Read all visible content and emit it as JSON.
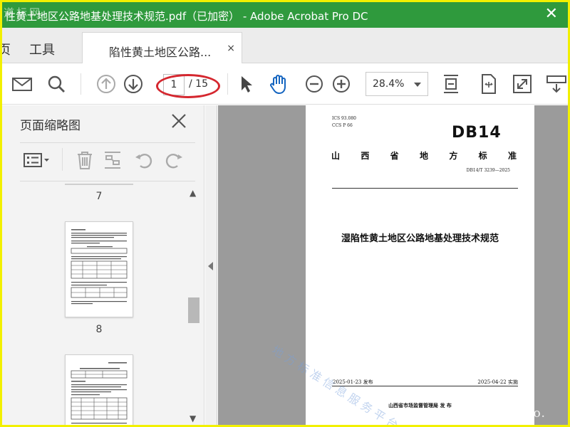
{
  "window": {
    "title": "性黄土地区公路地基处理技术规范.pdf（已加密） - Adobe Acrobat Pro DC",
    "close_glyph": "✕",
    "watermark_top_left": "道标网"
  },
  "nav": {
    "home_label": "页",
    "tools_label": "工具",
    "doc_tab_label": "陷性黄土地区公路...",
    "doc_tab_close": "×"
  },
  "toolbar": {
    "icons": [
      "mail-icon",
      "search-icon",
      "arrow-up-icon",
      "arrow-down-icon",
      "select-pointer-icon",
      "hand-icon",
      "zoom-out-icon",
      "zoom-in-icon",
      "fit-page-icon",
      "rotate-icon",
      "fullscreen-icon",
      "read-mode-icon"
    ],
    "current_page": "1",
    "total_pages": "/ 15",
    "zoom_value": "28.4%",
    "accent_color": "#1565c0",
    "annotation_color": "#d5272f"
  },
  "thumbnail_panel": {
    "title": "页面缩略图",
    "close_glyph": "✕",
    "icons": [
      "page-options-icon",
      "delete-icon",
      "extract-icon",
      "undo-icon",
      "redo-icon"
    ],
    "pages": [
      {
        "number": "7"
      },
      {
        "number": "8"
      }
    ],
    "scroll_up": "▲",
    "scroll_down": "▼"
  },
  "document": {
    "ics_line": "ICS 93.080",
    "ccs_line": "CCS P 66",
    "code": "DB14",
    "province_chars": [
      "山",
      "西",
      "省",
      "地",
      "方",
      "标",
      "准"
    ],
    "standard_number": "DB14/T 3239—2025",
    "title": "湿陷性黄土地区公路地基处理技术规范",
    "publish_date": "2025-01-23 发布",
    "implement_date": "2025-04-22 实施",
    "issuer": "山西省市场监督管理局      发 布",
    "watermark_diag": "地方标准信息服务平台",
    "watermark_url": "www.cndao."
  },
  "colors": {
    "titlebar": "#2f9a3d",
    "outer_frame": "#f2f000",
    "doc_background": "#9b9b9b"
  }
}
